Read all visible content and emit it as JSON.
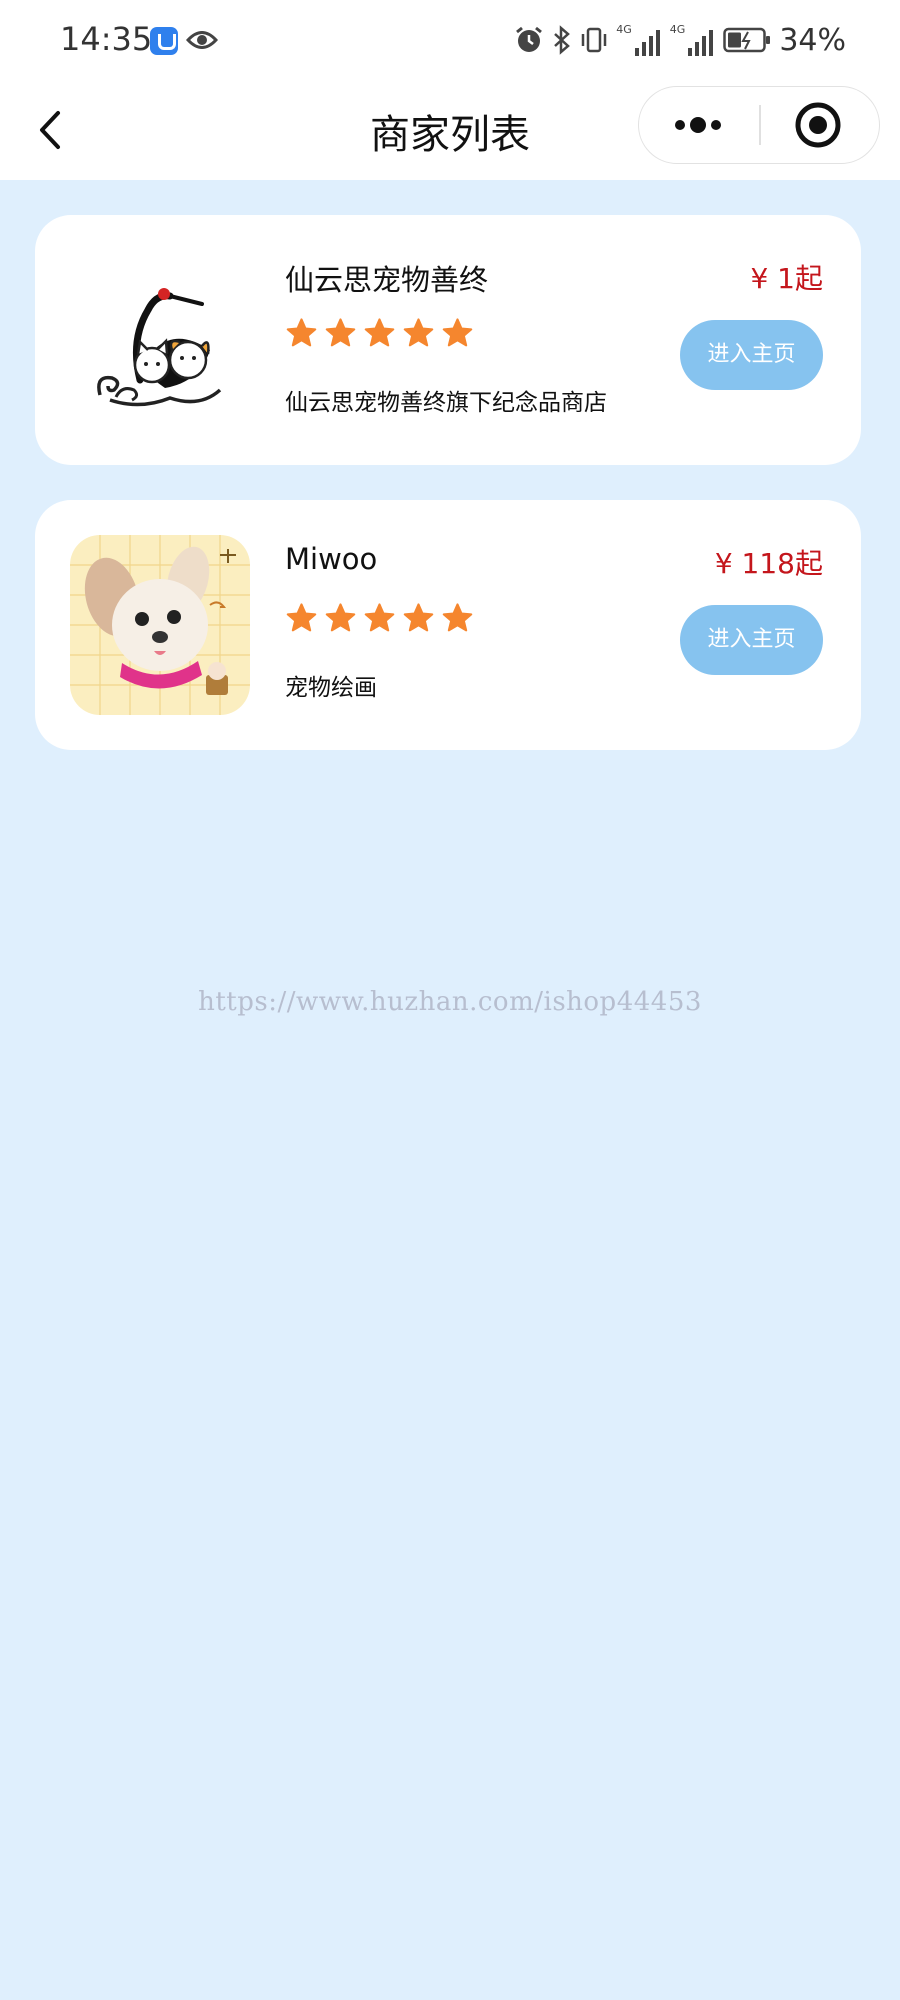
{
  "status_bar": {
    "time": "14:35",
    "battery": "34%",
    "network_1": "4G",
    "network_2": "4G",
    "icons": [
      "app-badge-icon",
      "eye-icon",
      "alarm-icon",
      "bluetooth-icon",
      "vibrate-icon",
      "signal-icon",
      "signal-icon",
      "battery-icon"
    ]
  },
  "nav": {
    "title": "商家列表",
    "back_icon": "chevron-left-icon",
    "more_icon": "more-dots-icon",
    "close_icon": "target-close-icon"
  },
  "merchants": [
    {
      "name": "仙云思宠物善终",
      "price": "¥ 1起",
      "rating": 5,
      "description": "仙云思宠物善终旗下纪念品商店",
      "button_label": "进入主页",
      "thumbnail": "crane-cat-dog-logo"
    },
    {
      "name": "Miwoo",
      "price": "¥ 118起",
      "rating": 5,
      "description": "宠物绘画",
      "button_label": "进入主页",
      "thumbnail": "puppy-painting"
    }
  ],
  "watermark": "https://www.huzhan.com/ishop44453",
  "colors": {
    "page_background": "#dfeffd",
    "price": "#c4161c",
    "button": "#86c3ef",
    "star": "#f5862e"
  }
}
